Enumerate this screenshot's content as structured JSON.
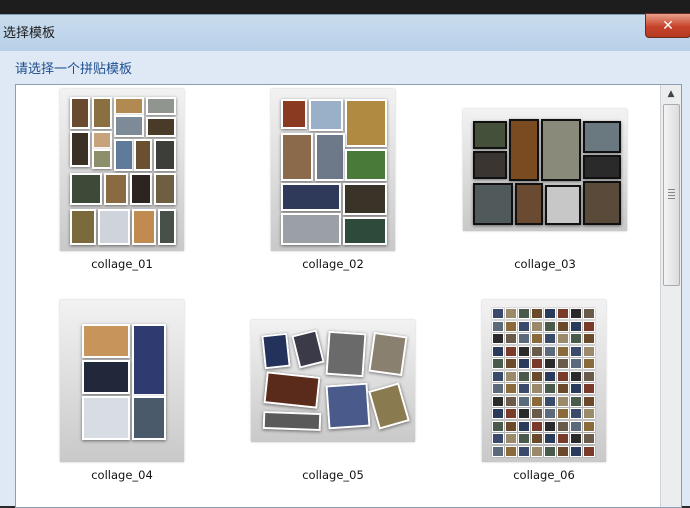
{
  "window": {
    "title": "选择模板",
    "close_glyph": "✕"
  },
  "dialog": {
    "prompt": "请选择一个拼贴模板"
  },
  "templates": [
    {
      "name": "collage_01"
    },
    {
      "name": "collage_02"
    },
    {
      "name": "collage_03"
    },
    {
      "name": "collage_04"
    },
    {
      "name": "collage_05"
    },
    {
      "name": "collage_06"
    }
  ],
  "scrollbar": {
    "up_glyph": "▲"
  }
}
